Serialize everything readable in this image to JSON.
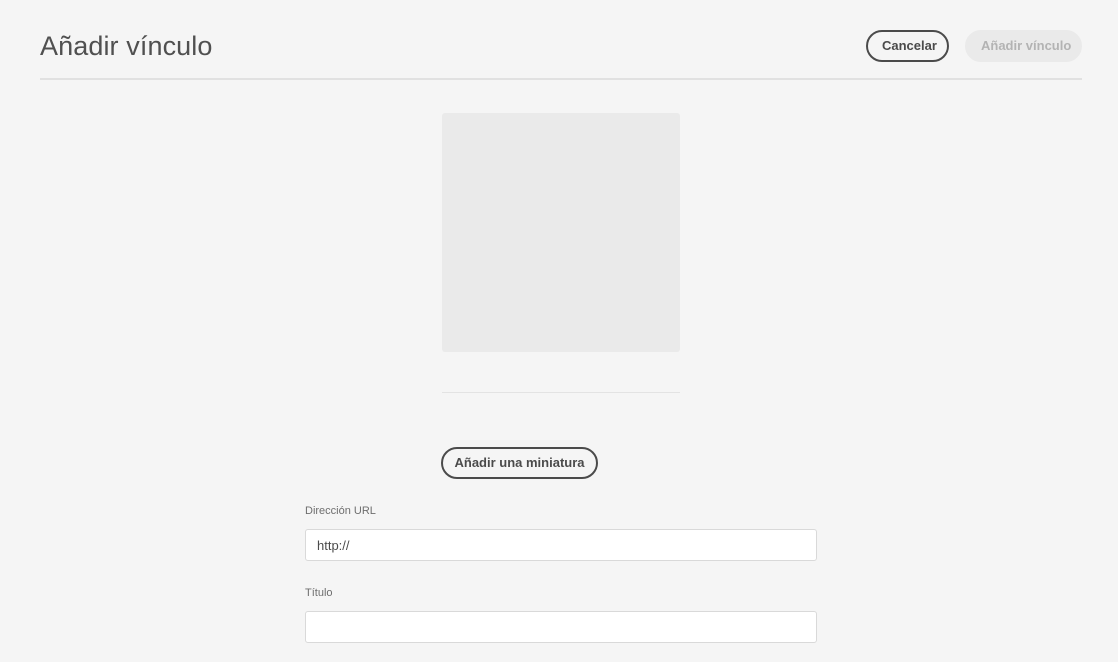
{
  "header": {
    "title": "Añadir vínculo",
    "cancel_label": "Cancelar",
    "add_link_label": "Añadir vínculo"
  },
  "thumbnail": {
    "add_button_label": "Añadir una miniatura"
  },
  "form": {
    "url": {
      "label": "Dirección URL",
      "value": "http://"
    },
    "title": {
      "label": "Título",
      "value": ""
    }
  }
}
